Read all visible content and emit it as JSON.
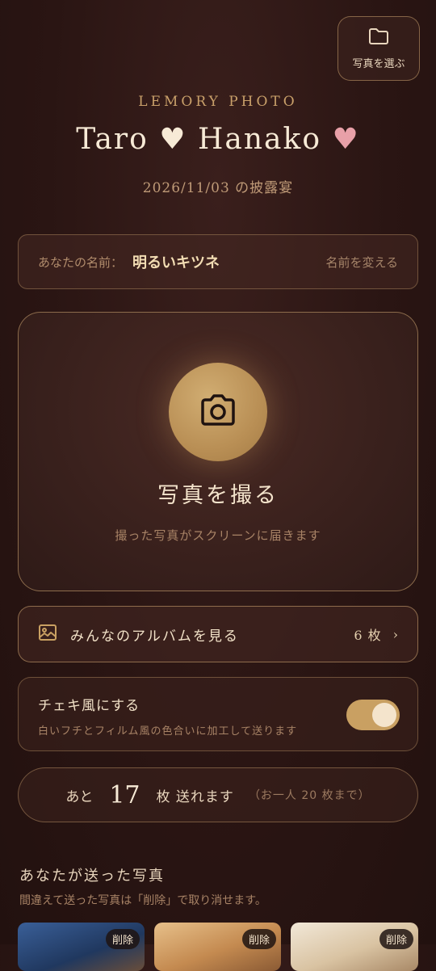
{
  "header": {
    "select_photos_label": "写真を選ぶ",
    "brand": "LEMORY PHOTO",
    "groom": "Taro",
    "bride": "Hanako",
    "heart": "♥",
    "date_line": "2026/11/03 の披露宴"
  },
  "name_card": {
    "label": "あなたの名前：",
    "value": "明るいキツネ",
    "change_label": "名前を変える"
  },
  "camera": {
    "title": "写真を撮る",
    "subtitle": "撮った写真がスクリーンに届きます"
  },
  "album": {
    "label": "みんなのアルバムを見る",
    "count": "6 枚",
    "chevron": "›"
  },
  "cheki": {
    "title": "チェキ風にする",
    "subtitle": "白いフチとフィルム風の色合いに加工して送ります",
    "enabled": true
  },
  "remaining": {
    "prefix": "あと",
    "count": "17",
    "suffix": "枚 送れます",
    "note": "（お一人 20 枚まで）"
  },
  "sent": {
    "title": "あなたが送った写真",
    "subtitle": "間違えて送った写真は「削除」で取り消せます。",
    "delete_label": "削除",
    "thumbnails": [
      {
        "color": "#2b4d84"
      },
      {
        "color": "#c9955f"
      },
      {
        "color": "#e8d9c2"
      }
    ]
  },
  "colors": {
    "accent_gold": "#c9a062",
    "bride_heart": "#e8a0a8",
    "background": "#2a1513"
  }
}
